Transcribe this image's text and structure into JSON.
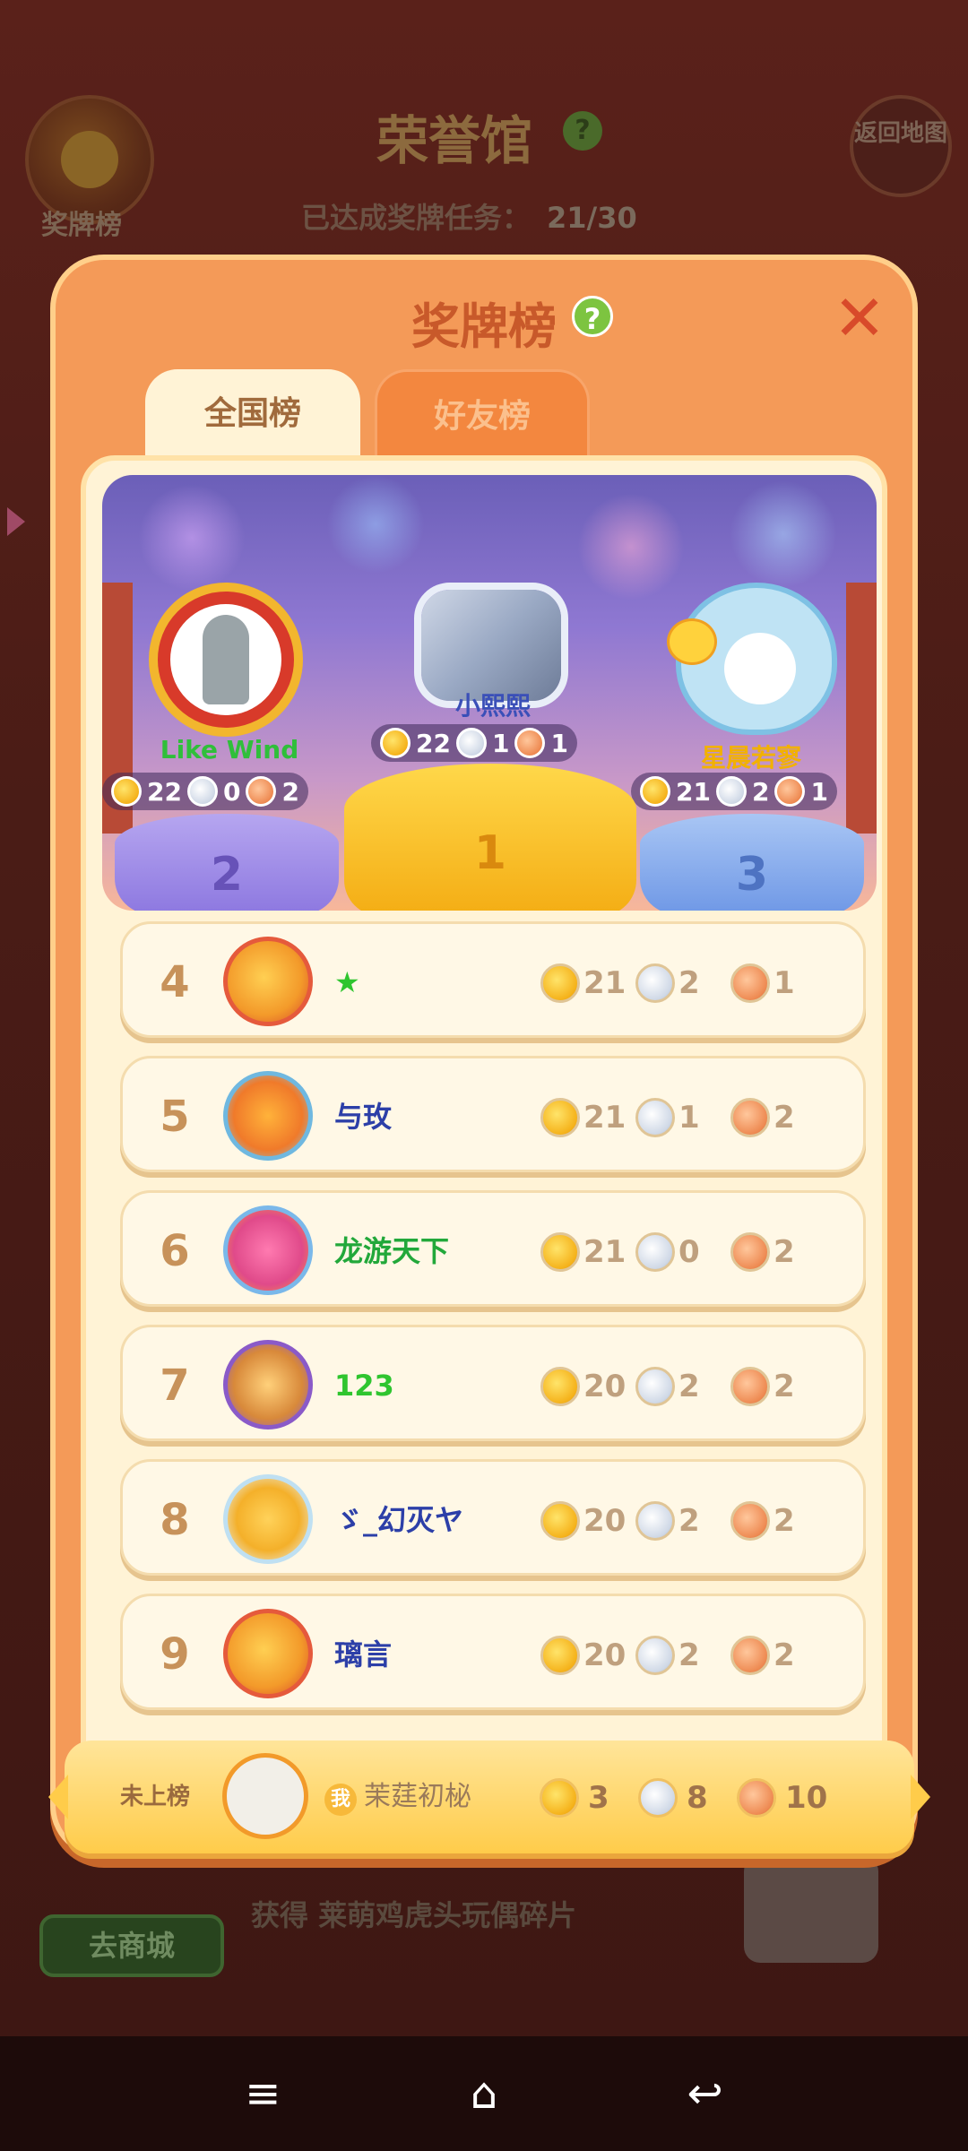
{
  "background": {
    "title": "荣誉馆",
    "help": "?",
    "medal_board_label": "奖牌榜",
    "back_label": "返回地图",
    "progress_label": "已达成奖牌任务：",
    "progress_value": "21/30",
    "reward_text": "获得 莱萌鸡虎头玩偶碎片",
    "shop_button": "去商城"
  },
  "modal": {
    "title": "奖牌榜",
    "help": "?",
    "close": "✕",
    "tabs": [
      {
        "label": "全国榜",
        "active": true
      },
      {
        "label": "好友榜",
        "active": false
      }
    ]
  },
  "podium": {
    "first": {
      "rank": "1",
      "name": "小熙熙",
      "gold": "22",
      "silver": "1",
      "bronze": "1"
    },
    "second": {
      "rank": "2",
      "name": "Like Wind",
      "gold": "22",
      "silver": "0",
      "bronze": "2"
    },
    "third": {
      "rank": "3",
      "name": "星晨若寥",
      "gold": "21",
      "silver": "2",
      "bronze": "1"
    }
  },
  "rows": [
    {
      "rank": "4",
      "name": "★",
      "name_color": "#2fc52f",
      "gold": "21",
      "silver": "2",
      "bronze": "1"
    },
    {
      "rank": "5",
      "name": "与玫",
      "name_color": "#2c3fa8",
      "gold": "21",
      "silver": "1",
      "bronze": "2"
    },
    {
      "rank": "6",
      "name": "龙游天下",
      "name_color": "#22a83a",
      "gold": "21",
      "silver": "0",
      "bronze": "2"
    },
    {
      "rank": "7",
      "name": "123",
      "name_color": "#2fc52f",
      "gold": "20",
      "silver": "2",
      "bronze": "2"
    },
    {
      "rank": "8",
      "name": "ゞ_幻灭ヤ",
      "name_color": "#2c3fa8",
      "gold": "20",
      "silver": "2",
      "bronze": "2"
    },
    {
      "rank": "9",
      "name": "璃言",
      "name_color": "#2c3fa8",
      "gold": "20",
      "silver": "2",
      "bronze": "2"
    }
  ],
  "self": {
    "status": "未上榜",
    "tag": "我",
    "name": "茉莛初柲",
    "gold": "3",
    "silver": "8",
    "bronze": "10"
  },
  "navbar": {
    "menu_icon": "≡",
    "home_icon": "⌂",
    "back_icon": "↩"
  },
  "colors": {
    "modal_bg": "#f49a58",
    "panel_bg": "#fff3d6",
    "title": "#c8592a",
    "gold_medal": "#f5b21a",
    "silver_medal": "#cfd8e6",
    "bronze_medal": "#ee8a52"
  }
}
